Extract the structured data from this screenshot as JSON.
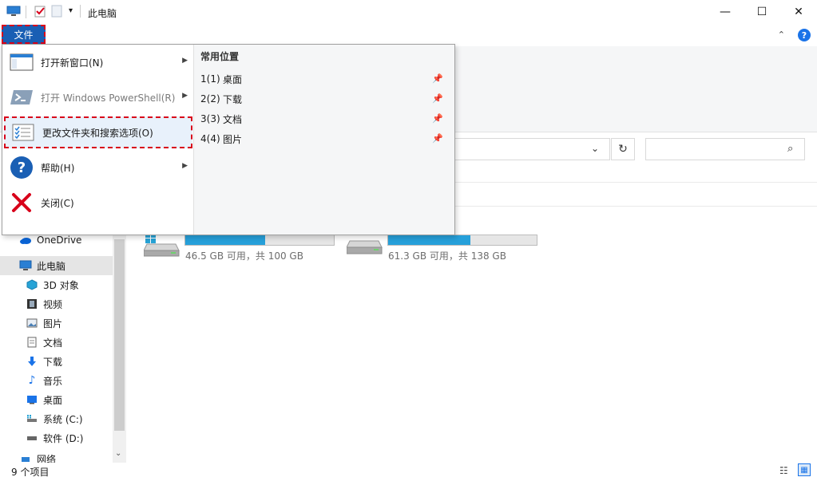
{
  "window": {
    "title": "此电脑",
    "controls": {
      "minimize": "—",
      "maximize": "☐",
      "close": "✕"
    }
  },
  "ribbon": {
    "file_tab": "文件",
    "toggle": "⌃",
    "help": "?"
  },
  "file_menu": {
    "items": [
      {
        "label": "打开新窗口(N)",
        "icon": "new-window-icon",
        "has_submenu": true,
        "enabled": true
      },
      {
        "label": "打开 Windows PowerShell(R)",
        "icon": "powershell-icon",
        "has_submenu": true,
        "enabled": false
      },
      {
        "label": "更改文件夹和搜索选项(O)",
        "icon": "folder-options-icon",
        "has_submenu": false,
        "enabled": true,
        "highlighted": true
      },
      {
        "label": "帮助(H)",
        "icon": "help-icon",
        "has_submenu": true,
        "enabled": true
      },
      {
        "label": "关闭(C)",
        "icon": "close-icon",
        "has_submenu": false,
        "enabled": true
      }
    ],
    "recent": {
      "title": "常用位置",
      "items": [
        {
          "num": "1(1)",
          "label": "桌面"
        },
        {
          "num": "2(2)",
          "label": "下载"
        },
        {
          "num": "3(3)",
          "label": "文档"
        },
        {
          "num": "4(4)",
          "label": "图片"
        }
      ]
    }
  },
  "address": {
    "dropdown": "⌄",
    "refresh": "↻",
    "search_icon": "⌕"
  },
  "nav": {
    "items": [
      {
        "label": "OneDrive",
        "icon": "onedrive-icon",
        "color": "#0a64d6"
      },
      {
        "label": "此电脑",
        "icon": "this-pc-icon",
        "selected": true
      },
      {
        "label": "3D 对象",
        "icon": "3d-objects-icon",
        "color": "#27a3d6"
      },
      {
        "label": "视频",
        "icon": "videos-icon"
      },
      {
        "label": "图片",
        "icon": "pictures-icon"
      },
      {
        "label": "文档",
        "icon": "documents-icon"
      },
      {
        "label": "下载",
        "icon": "downloads-icon",
        "color": "#1a73e8"
      },
      {
        "label": "音乐",
        "icon": "music-icon",
        "color": "#1a73e8"
      },
      {
        "label": "桌面",
        "icon": "desktop-icon",
        "color": "#1a73e8"
      },
      {
        "label": "系统 (C:)",
        "icon": "drive-c-icon"
      },
      {
        "label": "软件 (D:)",
        "icon": "drive-d-icon"
      },
      {
        "label": "网络",
        "icon": "network-icon"
      }
    ]
  },
  "drives": [
    {
      "free_text": "46.5 GB 可用，共 100 GB",
      "used_fraction": 0.535,
      "system": true
    },
    {
      "free_text": "61.3 GB 可用，共 138 GB",
      "used_fraction": 0.556,
      "system": false
    }
  ],
  "status": {
    "count": "9 个项目"
  },
  "colors": {
    "accent": "#1a5fb4",
    "highlight_border": "#d8001a",
    "drive_fill": "#26a0da"
  }
}
